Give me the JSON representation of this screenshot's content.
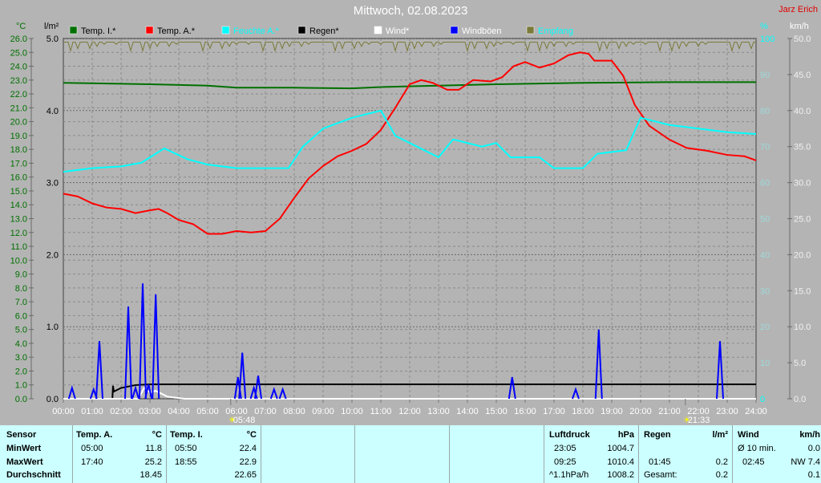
{
  "header": {
    "title": "Mittwoch, 02.08.2023",
    "author": "Jarz Erich"
  },
  "units": {
    "temp": "°C",
    "rain": "l/m²",
    "hum": "%",
    "wind": "km/h"
  },
  "legend": [
    {
      "label": "Temp. I.*",
      "color": "#007000",
      "text": "#000000"
    },
    {
      "label": "Temp. A.*",
      "color": "#ff0000",
      "text": "#000000"
    },
    {
      "label": "Feuchte A.*",
      "color": "#00ffff",
      "text": "#00ffff"
    },
    {
      "label": "Regen*",
      "color": "#000000",
      "text": "#000000"
    },
    {
      "label": "Wind*",
      "color": "#ffffff",
      "text": "#ffffff"
    },
    {
      "label": "Windböen",
      "color": "#0000ff",
      "text": "#ffffff"
    },
    {
      "label": "Empfang",
      "color": "#7a7a3a",
      "text": "#00ffff"
    }
  ],
  "sun": {
    "rise": "05:48",
    "set": "21:33"
  },
  "chart_data": {
    "type": "line",
    "title": "Mittwoch, 02.08.2023",
    "x_ticks": [
      "00:00",
      "01:00",
      "02:00",
      "03:00",
      "04:00",
      "05:00",
      "06:00",
      "07:00",
      "08:00",
      "09:00",
      "10:00",
      "11:00",
      "12:00",
      "13:00",
      "14:00",
      "15:00",
      "16:00",
      "17:00",
      "18:00",
      "19:00",
      "20:00",
      "21:00",
      "22:00",
      "23:00",
      "24:00"
    ],
    "xlim": [
      0,
      24
    ],
    "axes": {
      "temp": {
        "ylim": [
          0,
          26
        ],
        "step": 1
      },
      "rain": {
        "ylim": [
          0,
          5
        ],
        "step": 1
      },
      "hum": {
        "ylim": [
          0,
          100
        ],
        "step": 10
      },
      "wind": {
        "ylim": [
          0,
          50
        ],
        "step": 5
      }
    },
    "series": [
      {
        "name": "Temp. I.*",
        "axis": "temp",
        "color": "#007000",
        "points": [
          [
            0,
            22.8
          ],
          [
            3,
            22.7
          ],
          [
            5,
            22.6
          ],
          [
            6,
            22.45
          ],
          [
            8,
            22.45
          ],
          [
            10,
            22.4
          ],
          [
            11,
            22.5
          ],
          [
            13,
            22.6
          ],
          [
            15,
            22.7
          ],
          [
            18,
            22.8
          ],
          [
            21,
            22.85
          ],
          [
            24,
            22.85
          ]
        ]
      },
      {
        "name": "Temp. A.*",
        "axis": "temp",
        "color": "#ff0000",
        "points": [
          [
            0,
            14.8
          ],
          [
            0.5,
            14.6
          ],
          [
            1,
            14.1
          ],
          [
            1.5,
            13.8
          ],
          [
            2,
            13.7
          ],
          [
            2.5,
            13.4
          ],
          [
            3,
            13.6
          ],
          [
            3.3,
            13.7
          ],
          [
            3.6,
            13.4
          ],
          [
            4,
            12.9
          ],
          [
            4.5,
            12.6
          ],
          [
            5,
            11.9
          ],
          [
            5.5,
            11.9
          ],
          [
            6,
            12.1
          ],
          [
            6.5,
            12.0
          ],
          [
            7,
            12.1
          ],
          [
            7.5,
            13.0
          ],
          [
            8,
            14.5
          ],
          [
            8.5,
            15.9
          ],
          [
            9,
            16.8
          ],
          [
            9.5,
            17.5
          ],
          [
            10,
            17.9
          ],
          [
            10.5,
            18.4
          ],
          [
            11,
            19.4
          ],
          [
            11.5,
            21.0
          ],
          [
            12,
            22.7
          ],
          [
            12.4,
            23.0
          ],
          [
            12.8,
            22.8
          ],
          [
            13.3,
            22.3
          ],
          [
            13.7,
            22.3
          ],
          [
            14.2,
            23.0
          ],
          [
            14.8,
            22.9
          ],
          [
            15.2,
            23.2
          ],
          [
            15.6,
            24.0
          ],
          [
            16.0,
            24.3
          ],
          [
            16.5,
            23.9
          ],
          [
            17,
            24.2
          ],
          [
            17.5,
            24.8
          ],
          [
            17.9,
            25.0
          ],
          [
            18.2,
            24.9
          ],
          [
            18.4,
            24.4
          ],
          [
            19,
            24.4
          ],
          [
            19.4,
            23.3
          ],
          [
            19.8,
            21.2
          ],
          [
            20.3,
            19.7
          ],
          [
            21,
            18.7
          ],
          [
            21.6,
            18.1
          ],
          [
            22.3,
            17.9
          ],
          [
            23,
            17.6
          ],
          [
            23.6,
            17.5
          ],
          [
            24,
            17.2
          ]
        ]
      },
      {
        "name": "Feuchte A.*",
        "axis": "hum",
        "color": "#00ffff",
        "points": [
          [
            0,
            63
          ],
          [
            1,
            64
          ],
          [
            2,
            64.5
          ],
          [
            2.7,
            65.5
          ],
          [
            3.5,
            69.5
          ],
          [
            4.3,
            66.5
          ],
          [
            5,
            65
          ],
          [
            6,
            64
          ],
          [
            7,
            64
          ],
          [
            7.8,
            64
          ],
          [
            8.3,
            70
          ],
          [
            9,
            75
          ],
          [
            10,
            78
          ],
          [
            11,
            80
          ],
          [
            11.5,
            73
          ],
          [
            12.5,
            69
          ],
          [
            13,
            67
          ],
          [
            13.5,
            72
          ],
          [
            14.5,
            70
          ],
          [
            15,
            71
          ],
          [
            15.5,
            67
          ],
          [
            16.5,
            67
          ],
          [
            17,
            64
          ],
          [
            18,
            64
          ],
          [
            18.5,
            68
          ],
          [
            19.5,
            69
          ],
          [
            20,
            78
          ],
          [
            21,
            76
          ],
          [
            22,
            75
          ],
          [
            23,
            74
          ],
          [
            24,
            73.5
          ]
        ]
      },
      {
        "name": "Regen*",
        "axis": "rain",
        "color": "#000000",
        "points": [
          [
            0,
            0
          ],
          [
            1.7,
            0
          ],
          [
            1.72,
            0.18
          ],
          [
            1.75,
            0.1
          ],
          [
            2,
            0.15
          ],
          [
            2.5,
            0.19
          ],
          [
            3,
            0.2
          ],
          [
            24,
            0.2
          ]
        ]
      },
      {
        "name": "Wind*",
        "axis": "wind",
        "color": "#ffffff",
        "points": [
          [
            0,
            0
          ],
          [
            2.6,
            0
          ],
          [
            2.8,
            1.5
          ],
          [
            3.0,
            0.9
          ],
          [
            3.2,
            1.1
          ],
          [
            3.6,
            0.3
          ],
          [
            4.2,
            0
          ],
          [
            24,
            0
          ]
        ]
      },
      {
        "name": "Windböen",
        "axis": "wind",
        "color": "#0000ff",
        "spikes": [
          [
            0.3,
            1.5
          ],
          [
            1.05,
            1.3
          ],
          [
            1.25,
            8.0
          ],
          [
            2.25,
            12.8
          ],
          [
            2.5,
            1.5
          ],
          [
            2.75,
            16.0
          ],
          [
            2.95,
            2.0
          ],
          [
            3.2,
            14.5
          ],
          [
            6.05,
            3.0
          ],
          [
            6.2,
            6.4
          ],
          [
            6.6,
            1.5
          ],
          [
            6.75,
            3.2
          ],
          [
            7.3,
            1.3
          ],
          [
            7.6,
            1.3
          ],
          [
            15.55,
            3.0
          ],
          [
            17.75,
            1.3
          ],
          [
            18.55,
            9.6
          ],
          [
            22.75,
            8.0
          ]
        ]
      },
      {
        "name": "Empfang",
        "axis": "hum",
        "color": "#7a7a3a",
        "level": 99
      }
    ]
  },
  "table": {
    "sensor": {
      "h": "Sensor",
      "rows": [
        "MinWert",
        "MaxWert",
        "Durchschnitt"
      ]
    },
    "tempA": {
      "h": "Temp. A.",
      "u": "°C",
      "min_t": "05:00",
      "min": "11.8",
      "max_t": "17:40",
      "max": "25.2",
      "avg": "18.45"
    },
    "tempI": {
      "h": "Temp. I.",
      "u": "°C",
      "min_t": "05:50",
      "min": "22.4",
      "max_t": "18:55",
      "max": "22.9",
      "avg": "22.65"
    },
    "press": {
      "h": "Luftdruck",
      "u": "hPa",
      "min_t": "23:05",
      "min": "1004.7",
      "max_t": "09:25",
      "max": "1010.4",
      "avg_t": "^1.1hPa/h",
      "avg": "1008.2"
    },
    "rain": {
      "h": "Regen",
      "u": "l/m²",
      "max_t": "01:45",
      "max": "0.2",
      "avg_t": "Gesamt:",
      "avg": "0.2"
    },
    "wind": {
      "h": "Wind",
      "u": "km/h",
      "min_t": "Ø 10 min.",
      "min": "0.0",
      "max_t": "02:45",
      "max": "NW 7.4",
      "avg": "0.1"
    }
  }
}
